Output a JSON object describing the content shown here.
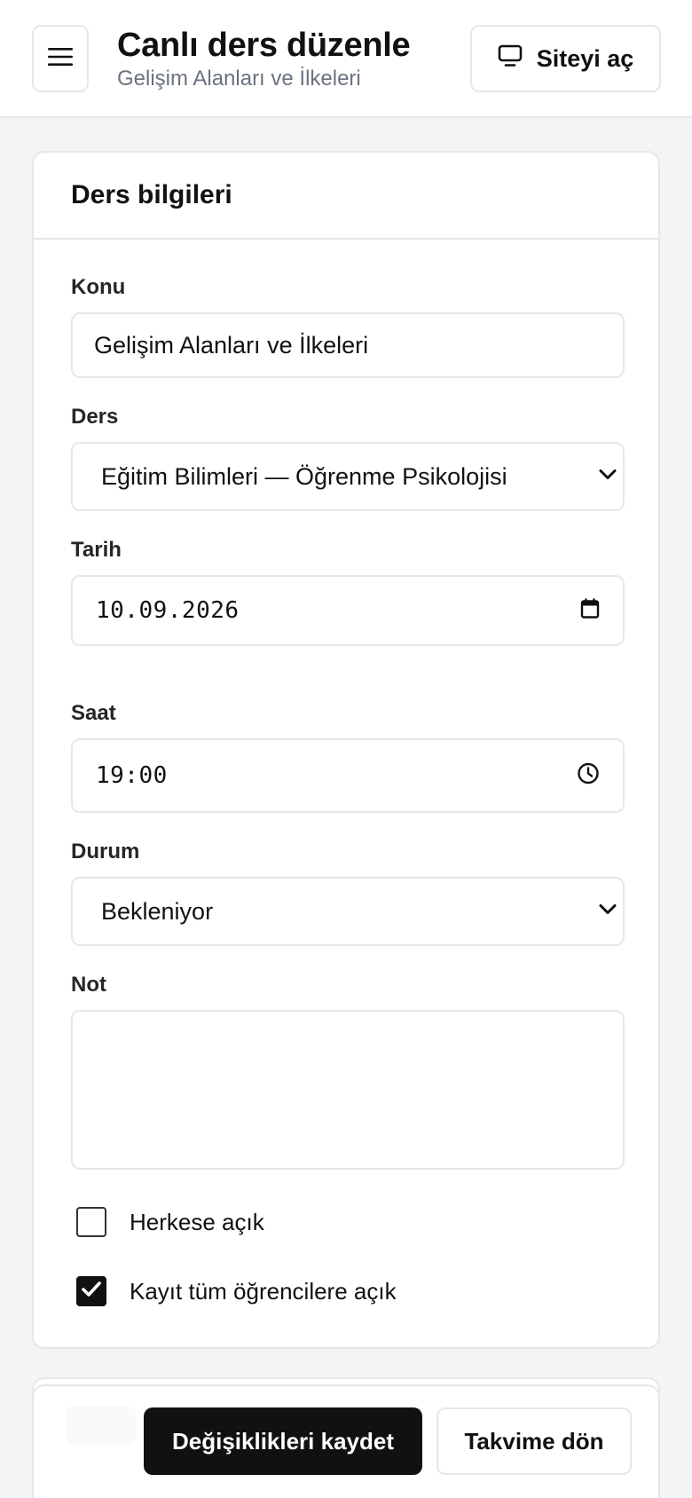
{
  "header": {
    "title": "Canlı ders düzenle",
    "subtitle": "Gelişim Alanları ve İlkeleri",
    "open_site_label": "Siteyi aç"
  },
  "card": {
    "title": "Ders bilgileri",
    "fields": {
      "konu": {
        "label": "Konu",
        "value": "Gelişim Alanları ve İlkeleri"
      },
      "ders": {
        "label": "Ders",
        "value": "Eğitim Bilimleri — Öğrenme Psikolojisi"
      },
      "tarih": {
        "label": "Tarih",
        "value": "10.09.2026"
      },
      "saat": {
        "label": "Saat",
        "value": "19:00"
      },
      "durum": {
        "label": "Durum",
        "value": "Bekleniyor"
      },
      "not": {
        "label": "Not",
        "value": ""
      }
    },
    "checkboxes": [
      {
        "label": "Herkese açık",
        "checked": false
      },
      {
        "label": "Kayıt tüm öğrencilere açık",
        "checked": true
      }
    ]
  },
  "actions": {
    "save_label": "Değişiklikleri kaydet",
    "back_label": "Takvime dön"
  },
  "icons": {
    "menu": "menu-icon",
    "monitor": "monitor-icon",
    "chevron": "chevron-down-icon",
    "calendar": "calendar-icon",
    "clock": "clock-icon",
    "check": "check-icon"
  }
}
